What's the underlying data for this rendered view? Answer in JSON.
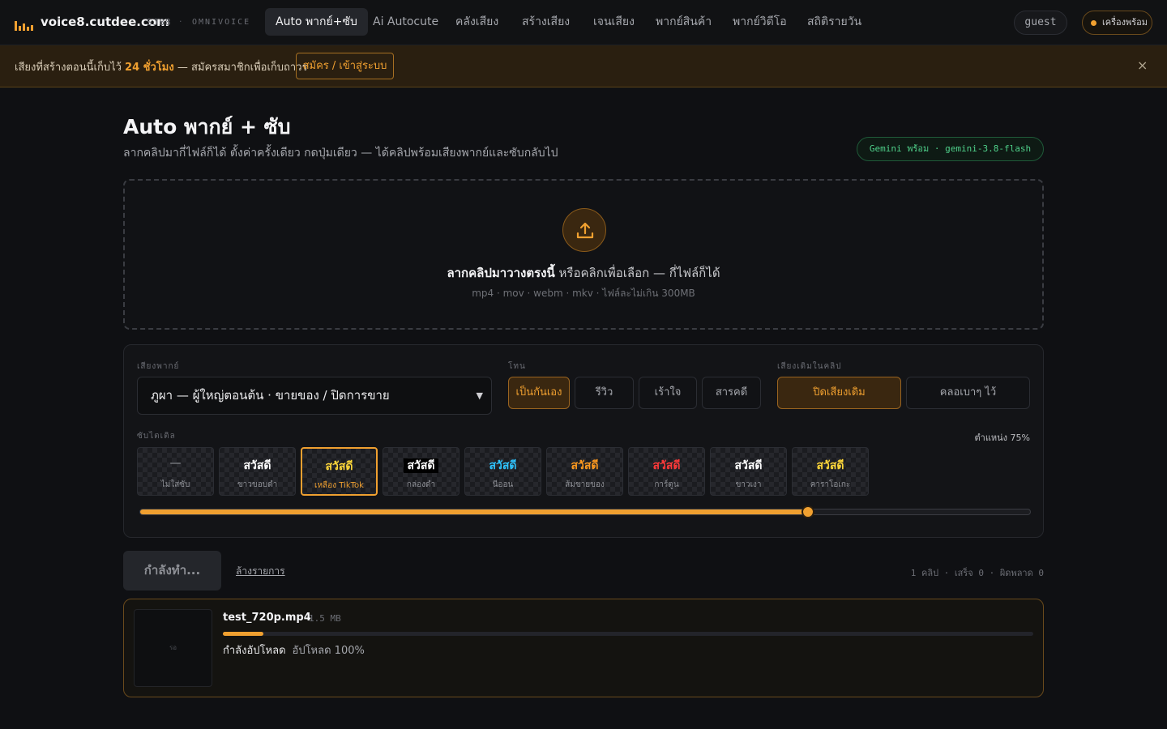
{
  "nav": {
    "brand": "voice8.cutdee.com",
    "brand_code": "SJ88",
    "brand_dot": "·",
    "brand_sub": "OMNIVOICE",
    "items": [
      {
        "label": "Auto พากย์+ซับ",
        "active": true
      },
      {
        "label": "Ai Autocute",
        "active": false
      },
      {
        "label": "คลังเสียง",
        "active": false
      },
      {
        "label": "สร้างเสียง",
        "active": false
      },
      {
        "label": "เจนเสียง",
        "active": false
      },
      {
        "label": "พากย์สินค้า",
        "active": false
      },
      {
        "label": "พากย์วิดีโอ",
        "active": false
      },
      {
        "label": "สถิติรายวัน",
        "active": false
      }
    ],
    "user": "guest",
    "status": "เครื่องพร้อม",
    "accent": "#f0a030",
    "logo_icon": "audio-bars-icon"
  },
  "banner": {
    "text_before": "เสียงที่สร้างตอนนี้เก็บไว้ ",
    "highlight": "24 ชั่วโมง",
    "text_after": " — สมัครสมาชิกเพื่อเก็บถาวร",
    "button": "สมัคร / เข้าสู่ระบบ",
    "close": "×",
    "close_icon": "close-icon"
  },
  "header": {
    "title": "Auto พากย์ + ซับ",
    "subtitle": "ลากคลิปมากี่ไฟล์ก็ได้ ตั้งค่าครั้งเดียว กดปุ่มเดียว — ได้คลิปพร้อมเสียงพากย์และซับกลับไป",
    "badge": "Gemini พร้อม · gemini-3.8-flash",
    "badge_color": "#4fd08a"
  },
  "dropzone": {
    "icon": "upload-icon",
    "main_bold": "ลากคลิปมาวางตรงนี้",
    "main_rest": " หรือคลิกเพื่อเลือก — กี่ไฟล์ก็ได้",
    "hint": "mp4 · mov · webm · mkv · ไฟล์ละไม่เกิน 300MB"
  },
  "settings": {
    "voice_label": "เสียงพากย์",
    "voice_value": "ภูผา — ผู้ใหญ่ตอนต้น · ขายของ / ปิดการขาย",
    "voice_chevron": "chevron-down-icon",
    "tone_label": "โทน",
    "tones": [
      {
        "label": "เป็นกันเอง",
        "active": true
      },
      {
        "label": "รีวิว",
        "active": false
      },
      {
        "label": "เร้าใจ",
        "active": false
      },
      {
        "label": "สารคดี",
        "active": false
      }
    ],
    "orig_audio_label": "เสียงเดิมในคลิป",
    "orig_audio": [
      {
        "label": "ปิดเสียงเดิม",
        "active": true
      },
      {
        "label": "คลอเบาๆ ไว้",
        "active": false
      }
    ],
    "subtitle_label": "ซับไตเติล",
    "position_label": "ตำแหน่ง 75%",
    "position_value": 0.75,
    "styles": [
      {
        "sample": "—",
        "caption": "ไม่ใส่ซับ",
        "color": "#9a9ca2",
        "bg": "",
        "active": false
      },
      {
        "sample": "สวัสดี",
        "caption": "ขาวขอบดำ",
        "color": "#ffffff",
        "bg": "",
        "active": false
      },
      {
        "sample": "สวัสดี",
        "caption": "เหลือง TikTok",
        "color": "#ffd83a",
        "bg": "",
        "active": true
      },
      {
        "sample": "สวัสดี",
        "caption": "กล่องดำ",
        "color": "#ffffff",
        "bg": "#000000",
        "active": false
      },
      {
        "sample": "สวัสดี",
        "caption": "นีออน",
        "color": "#2fc4ff",
        "bg": "",
        "active": false
      },
      {
        "sample": "สวัสดี",
        "caption": "ส้มขายของ",
        "color": "#ff9a1f",
        "bg": "",
        "active": false
      },
      {
        "sample": "สวัสดี",
        "caption": "การ์ตูน",
        "color": "#ff3a3a",
        "bg": "",
        "active": false
      },
      {
        "sample": "สวัสดี",
        "caption": "ขาวเงา",
        "color": "#ffffff",
        "bg": "",
        "active": false
      },
      {
        "sample": "สวัสดี",
        "caption": "คาราโอเกะ",
        "color": "#ffd83a",
        "bg": "",
        "active": false
      }
    ]
  },
  "actions": {
    "run": "กำลังทำ...",
    "clear": "ล้างรายการ",
    "counts": "1 คลิป · เสร็จ 0 · ผิดพลาด 0"
  },
  "job": {
    "thumb": "รอ",
    "name": "test_720p.mp4",
    "size": "1.5 MB",
    "progress": 0.05,
    "status": "กำลังอัปโหลด",
    "detail": "อัปโหลด 100%"
  }
}
